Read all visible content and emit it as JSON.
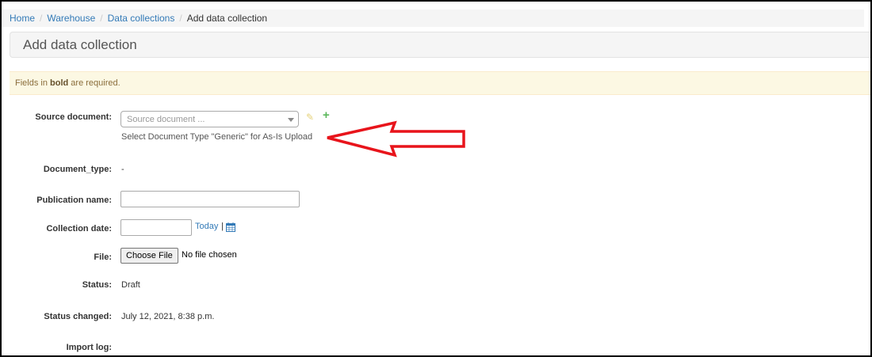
{
  "breadcrumb": {
    "items": [
      "Home",
      "Warehouse",
      "Data collections"
    ],
    "current": "Add data collection",
    "separator": "/"
  },
  "page": {
    "title": "Add data collection"
  },
  "alert": {
    "prefix": "Fields in ",
    "bold": "bold",
    "suffix": " are required."
  },
  "form": {
    "source_document": {
      "label": "Source document:",
      "placeholder": "Source document ...",
      "help": "Select Document Type \"Generic\" for As-Is Upload"
    },
    "document_type": {
      "label": "Document_type:",
      "value": "-"
    },
    "publication_name": {
      "label": "Publication name:",
      "value": ""
    },
    "collection_date": {
      "label": "Collection date:",
      "value": "",
      "today": "Today",
      "separator": "|"
    },
    "file": {
      "label": "File:",
      "button": "Choose File",
      "status": "No file chosen"
    },
    "status": {
      "label": "Status:",
      "value": "Draft"
    },
    "status_changed": {
      "label": "Status changed:",
      "value": "July 12, 2021, 8:38 p.m."
    },
    "import_log": {
      "label": "Import log:"
    }
  },
  "icons": {
    "edit": "pencil-icon",
    "add": "plus-icon",
    "calendar": "calendar-icon",
    "dropdown": "chevron-down-icon",
    "annotation": "arrow-left-icon"
  },
  "colors": {
    "link": "#337ab7",
    "add": "#5cb85c",
    "edit": "#e6d27a",
    "alert_bg": "#fcf8e3",
    "annotation": "#e8141b"
  }
}
